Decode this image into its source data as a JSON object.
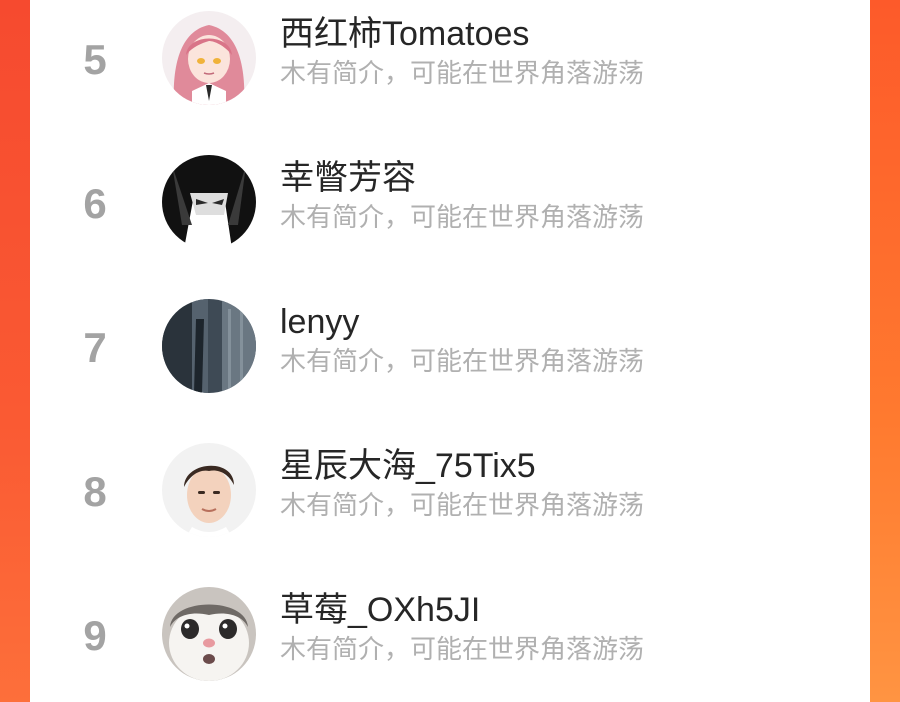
{
  "colors": {
    "background_accent": "#fb4f2e",
    "rank_number": "#a3a3a3",
    "username": "#262626",
    "bio": "#b0b0b0"
  },
  "ranking": {
    "rows": [
      {
        "rank": "5",
        "name": "西红柿Tomatoes",
        "bio": "木有简介，可能在世界角落游荡",
        "avatar": "anime-girl-pink-hair-avatar"
      },
      {
        "rank": "6",
        "name": "幸瞥芳容",
        "bio": "木有简介，可能在世界角落游荡",
        "avatar": "anime-dark-hair-avatar"
      },
      {
        "rank": "7",
        "name": "lenyy",
        "bio": "木有简介，可能在世界角落游荡",
        "avatar": "dark-scenery-avatar"
      },
      {
        "rank": "8",
        "name": "星辰大海_75Tix5",
        "bio": "木有简介，可能在世界角落游荡",
        "avatar": "young-man-photo-avatar"
      },
      {
        "rank": "9",
        "name": "草莓_OXh5JI",
        "bio": "木有简介，可能在世界角落游荡",
        "avatar": "cat-face-avatar"
      }
    ]
  }
}
